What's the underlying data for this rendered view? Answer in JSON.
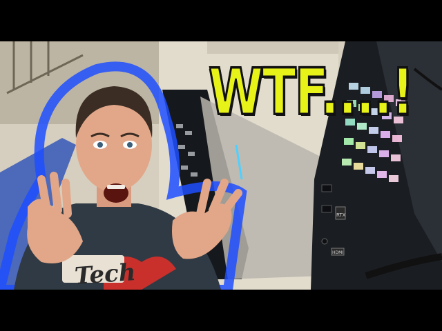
{
  "caption": "WTF....!",
  "shirt_text": "Tech",
  "port_labels": [
    "RTX",
    "HDMI"
  ],
  "colors": {
    "caption_fill": "#e7f318",
    "caption_outline": "#111111",
    "glow": "#1f4fff",
    "shirt": "#2f3a44",
    "heart": "#c9302c",
    "laptop_body": "#1a1d22"
  },
  "icons": [
    "usb-port-icon",
    "hdmi-port-icon",
    "gpu-badge-icon"
  ]
}
